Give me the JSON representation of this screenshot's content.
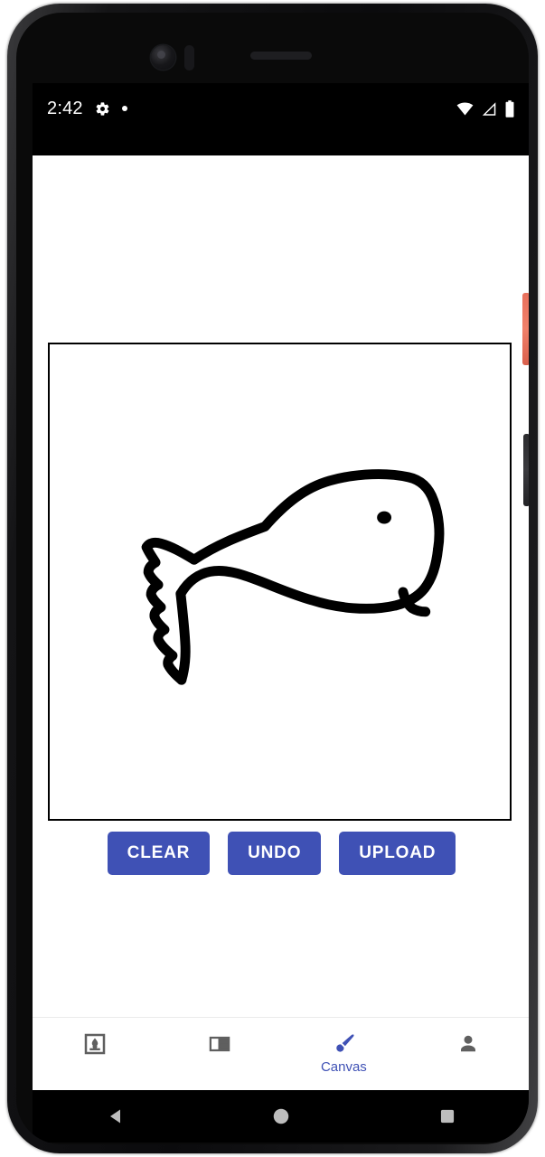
{
  "status_bar": {
    "time": "2:42",
    "left_icons": [
      {
        "name": "gear-icon",
        "label": "settings"
      },
      {
        "name": "notification-dot-icon",
        "label": "notification"
      }
    ],
    "right_icons": [
      {
        "name": "wifi-icon",
        "label": "wifi"
      },
      {
        "name": "cellular-signal-icon",
        "label": "signal"
      },
      {
        "name": "battery-icon",
        "label": "battery"
      }
    ],
    "background": "#000000",
    "foreground": "#ffffff"
  },
  "app": {
    "canvas": {
      "label": "Drawing canvas",
      "background": "#ffffff",
      "border_color": "#000000",
      "stroke_color": "#000000",
      "drawing_description": "Hand-drawn fish facing right with a jagged forked tail, a dot eye and a small mouth line"
    },
    "buttons": [
      {
        "name": "clear-button",
        "label": "CLEAR"
      },
      {
        "name": "undo-button",
        "label": "UNDO"
      },
      {
        "name": "upload-button",
        "label": "UPLOAD"
      }
    ],
    "button_color": "#3f51b5",
    "button_text_color": "#ffffff"
  },
  "bottom_nav": {
    "active_color": "#3f51b5",
    "inactive_color": "#5f5f5f",
    "items": [
      {
        "name": "nav-fireplace",
        "icon": "fireplace-icon",
        "label": "",
        "active": false
      },
      {
        "name": "nav-articles",
        "icon": "article-icon",
        "label": "",
        "active": false
      },
      {
        "name": "nav-canvas",
        "icon": "paintbrush-icon",
        "label": "Canvas",
        "active": true
      },
      {
        "name": "nav-profile",
        "icon": "person-icon",
        "label": "",
        "active": false
      }
    ]
  },
  "system_nav": {
    "buttons": [
      {
        "name": "back-button",
        "icon": "back-triangle-icon"
      },
      {
        "name": "home-button",
        "icon": "home-circle-icon"
      },
      {
        "name": "recents-button",
        "icon": "recents-square-icon"
      }
    ],
    "icon_color": "#bdbdbd",
    "background": "#000000"
  },
  "device": {
    "power_button_color": "#ea7460",
    "volume_button_color": "#2f2f33"
  }
}
